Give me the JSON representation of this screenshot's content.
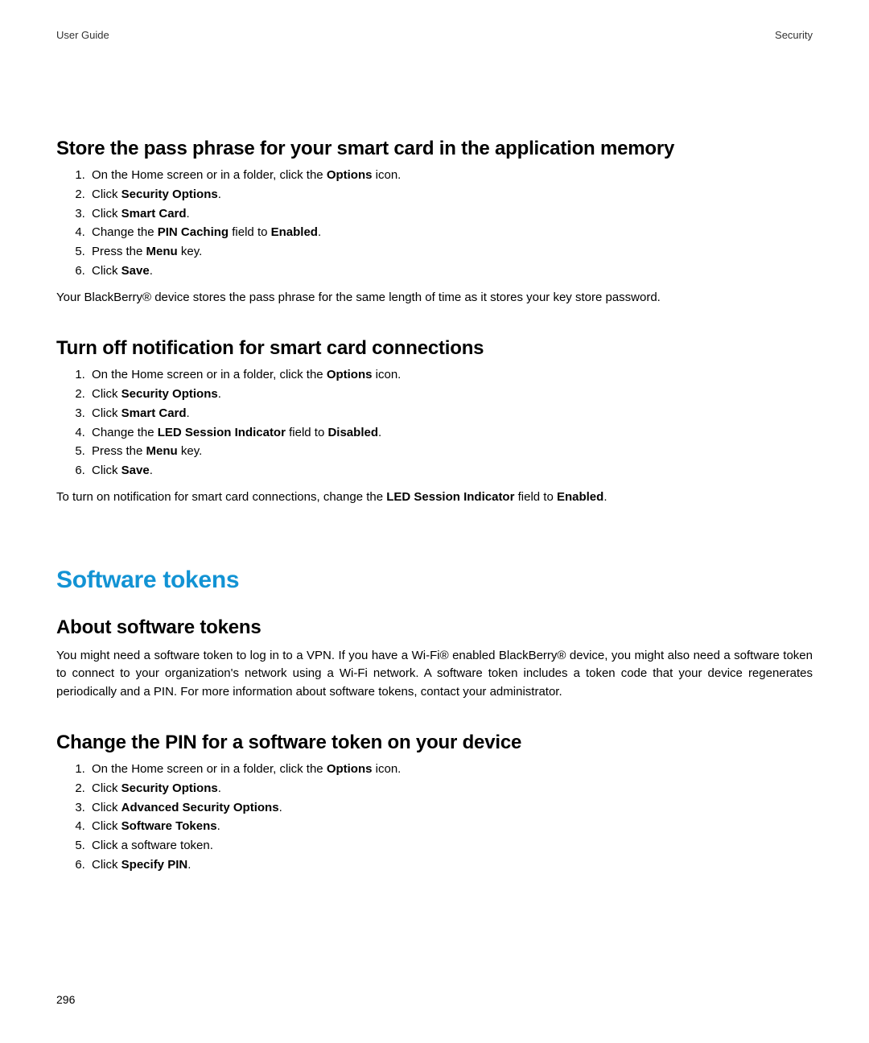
{
  "header": {
    "left": "User Guide",
    "right": "Security"
  },
  "section1": {
    "heading": "Store the pass phrase for your smart card in the application memory",
    "steps": [
      {
        "pre": "On the Home screen or in a folder, click the ",
        "b1": "Options",
        "post": " icon."
      },
      {
        "pre": "Click ",
        "b1": "Security Options",
        "post": "."
      },
      {
        "pre": "Click ",
        "b1": "Smart Card",
        "post": "."
      },
      {
        "pre": "Change the ",
        "b1": "PIN Caching",
        "mid": " field to ",
        "b2": "Enabled",
        "post": "."
      },
      {
        "pre": "Press the ",
        "b1": "Menu",
        "post": " key."
      },
      {
        "pre": "Click ",
        "b1": "Save",
        "post": "."
      }
    ],
    "note": "Your BlackBerry® device stores the pass phrase for the same length of time as it stores your key store password."
  },
  "section2": {
    "heading": "Turn off notification for smart card connections",
    "steps": [
      {
        "pre": "On the Home screen or in a folder, click the ",
        "b1": "Options",
        "post": " icon."
      },
      {
        "pre": "Click ",
        "b1": "Security Options",
        "post": "."
      },
      {
        "pre": "Click ",
        "b1": "Smart Card",
        "post": "."
      },
      {
        "pre": "Change the ",
        "b1": "LED Session Indicator",
        "mid": " field to ",
        "b2": "Disabled",
        "post": "."
      },
      {
        "pre": "Press the ",
        "b1": "Menu",
        "post": " key."
      },
      {
        "pre": "Click ",
        "b1": "Save",
        "post": "."
      }
    ],
    "note_pre": "To turn on notification for smart card connections, change the ",
    "note_b1": "LED Session Indicator",
    "note_mid": " field to ",
    "note_b2": "Enabled",
    "note_post": "."
  },
  "chapter": {
    "heading": "Software tokens"
  },
  "section3": {
    "heading": "About software tokens",
    "body": "You might need a software token to log in to a VPN. If you have a Wi-Fi® enabled BlackBerry® device, you might also need a software token to connect to your organization's network using a Wi-Fi network. A software token includes a token code that your device regenerates periodically and a PIN. For more information about software tokens, contact your administrator."
  },
  "section4": {
    "heading": "Change the PIN for a software token on your device",
    "steps": [
      {
        "pre": "On the Home screen or in a folder, click the ",
        "b1": "Options",
        "post": " icon."
      },
      {
        "pre": "Click ",
        "b1": "Security Options",
        "post": "."
      },
      {
        "pre": "Click ",
        "b1": "Advanced Security Options",
        "post": "."
      },
      {
        "pre": "Click ",
        "b1": "Software Tokens",
        "post": "."
      },
      {
        "pre": "Click a software token."
      },
      {
        "pre": "Click ",
        "b1": "Specify PIN",
        "post": "."
      }
    ]
  },
  "footer": {
    "page_number": "296"
  }
}
